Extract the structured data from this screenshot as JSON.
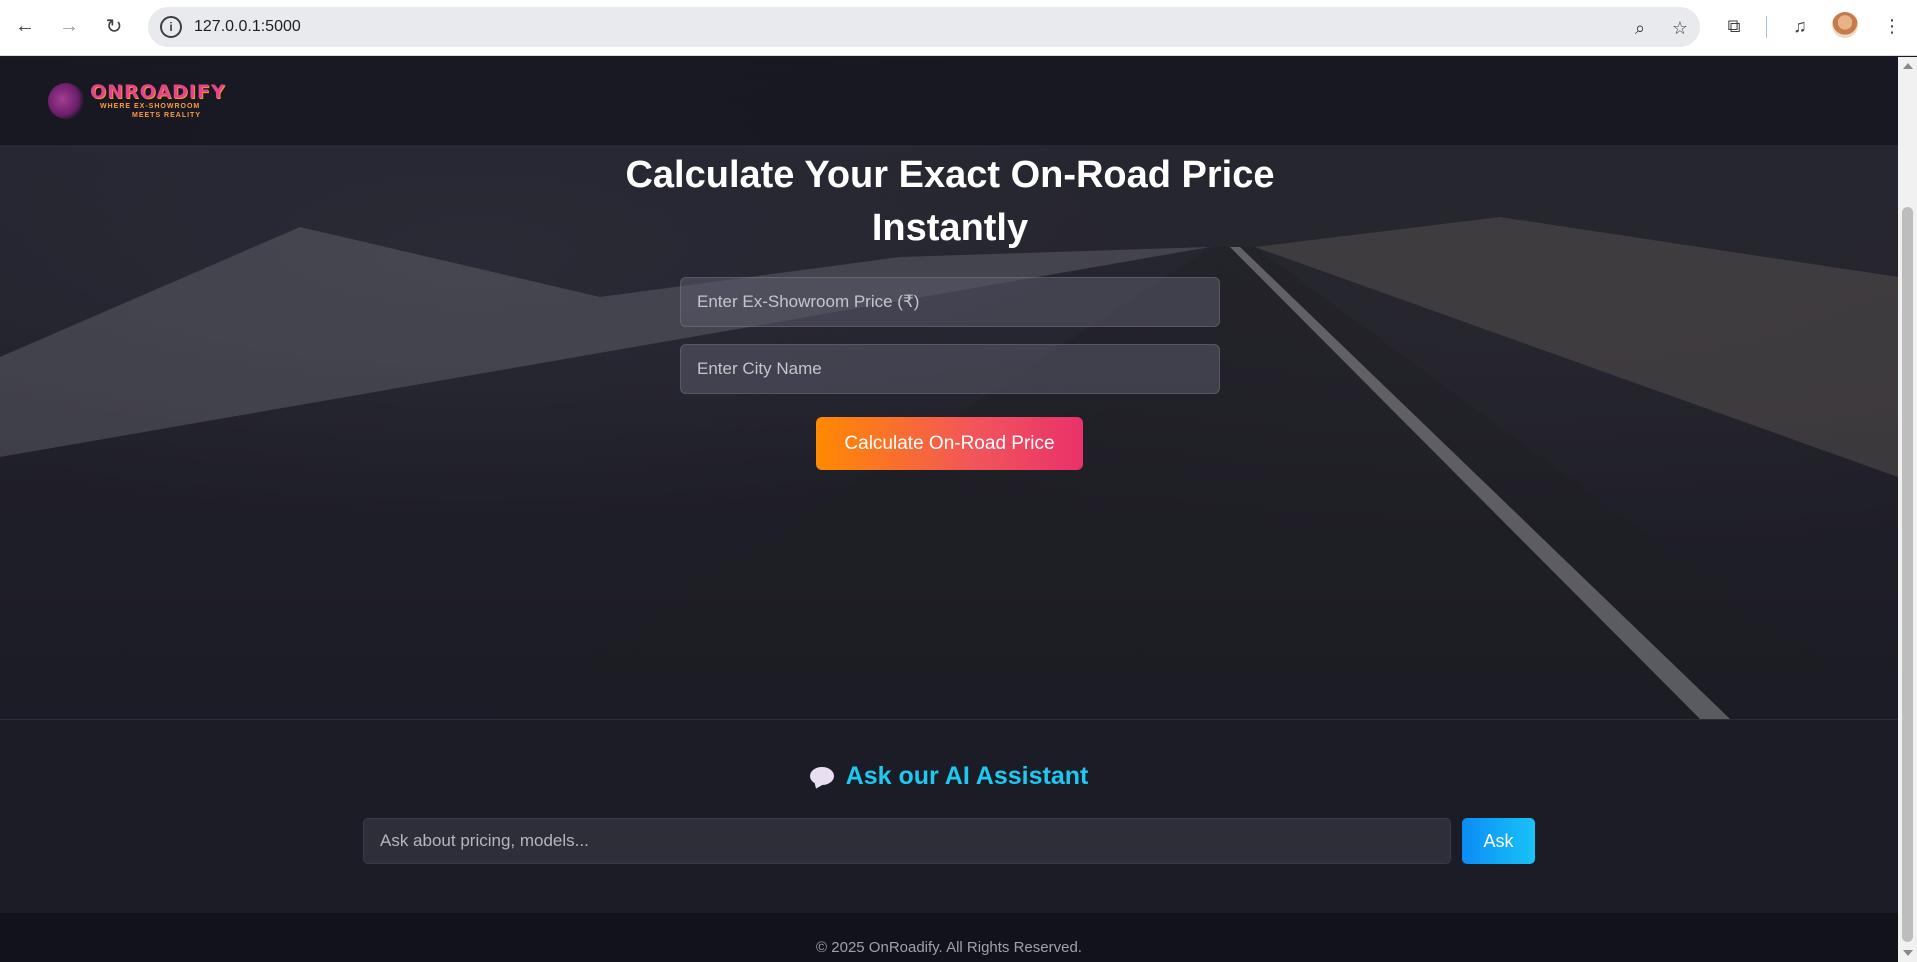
{
  "browser": {
    "url": "127.0.0.1:5000"
  },
  "header": {
    "logo_name": "ONROADIFY",
    "logo_tagline_1": "WHERE EX-SHOWROOM",
    "logo_tagline_2": "MEETS REALITY"
  },
  "hero": {
    "title": "Calculate Your Exact On-Road Price Instantly",
    "price_placeholder": "Enter Ex-Showroom Price (₹)",
    "city_placeholder": "Enter City Name",
    "calculate_label": "Calculate On-Road Price"
  },
  "assistant": {
    "title": "Ask our AI Assistant",
    "input_placeholder": "Ask about pricing, models...",
    "ask_label": "Ask"
  },
  "footer": {
    "text": "© 2025 OnRoadify. All Rights Reserved."
  },
  "colors": {
    "accent_orange": "#ff8a00",
    "accent_pink": "#e9316a",
    "assistant_cyan": "#1ec8f0",
    "ask_blue": "#0b8cf5"
  }
}
